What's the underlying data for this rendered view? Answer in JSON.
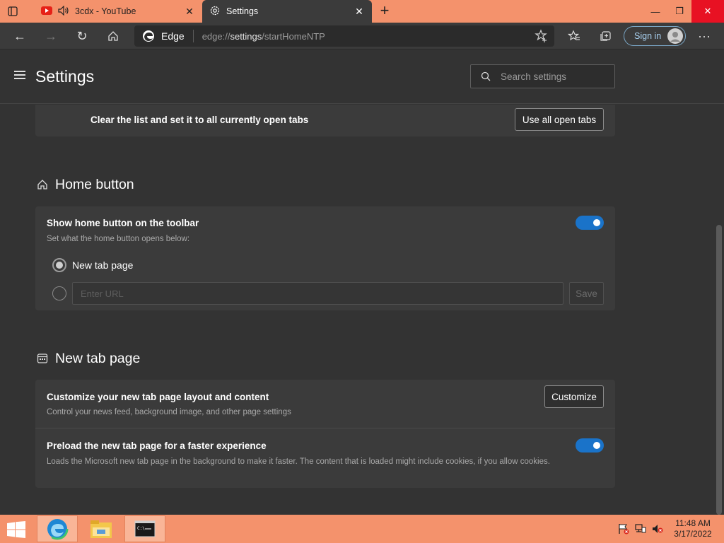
{
  "browser": {
    "tabs": [
      {
        "title": "3cdx - YouTube",
        "active": false
      },
      {
        "title": "Settings",
        "active": true
      }
    ],
    "address": {
      "site_label": "Edge",
      "url_prefix": "edge://",
      "url_host": "settings",
      "url_path": "/startHomeNTP"
    },
    "signin_label": "Sign in",
    "more_label": "···"
  },
  "settings": {
    "title": "Settings",
    "search_placeholder": "Search settings",
    "open_tabs_row": {
      "label": "Clear the list and set it to all currently open tabs",
      "button": "Use all open tabs"
    },
    "home_button": {
      "section_title": "Home button",
      "show_label": "Show home button on the toolbar",
      "show_sub": "Set what the home button opens below:",
      "show_enabled": true,
      "option_new_tab": "New tab page",
      "option_url_placeholder": "Enter URL",
      "save_label": "Save"
    },
    "new_tab_page": {
      "section_title": "New tab page",
      "customize_label": "Customize your new tab page layout and content",
      "customize_sub": "Control your news feed, background image, and other page settings",
      "customize_button": "Customize",
      "preload_label": "Preload the new tab page for a faster experience",
      "preload_sub": "Loads the Microsoft new tab page in the background to make it faster. The content that is loaded might include cookies, if you allow cookies.",
      "preload_enabled": true
    }
  },
  "taskbar": {
    "time": "11:48 AM",
    "date": "3/17/2022"
  },
  "colors": {
    "accent": "#f4926c",
    "toggle_on": "#1a73c9",
    "background": "#333333",
    "card": "#3b3b3b"
  }
}
